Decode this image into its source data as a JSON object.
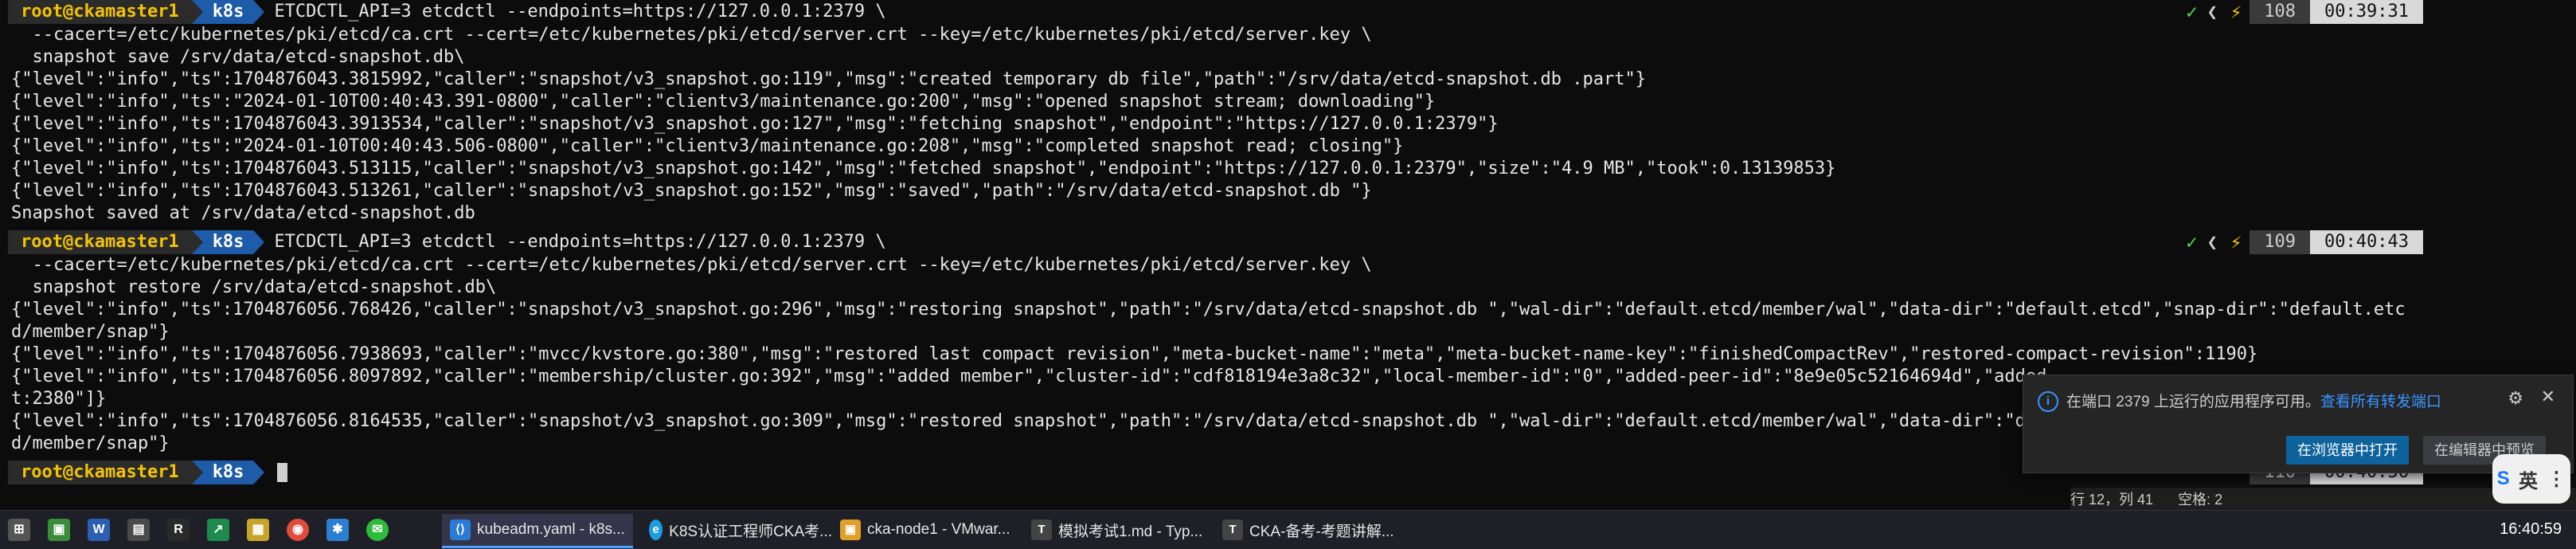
{
  "terminal": {
    "prompts": [
      {
        "user": "root@ckamaster1",
        "dir": "k8s",
        "command": "ETCDCTL_API=3 etcdctl --endpoints=https://127.0.0.1:2379 \\",
        "status": {
          "check": "✓",
          "sep": "❮",
          "bolt": "⚡",
          "count": "108",
          "time": "00:39:31"
        }
      },
      {
        "user": "root@ckamaster1",
        "dir": "k8s",
        "command": "ETCDCTL_API=3 etcdctl --endpoints=https://127.0.0.1:2379 \\",
        "status": {
          "check": "✓",
          "sep": "❮",
          "bolt": "⚡",
          "count": "109",
          "time": "00:40:43"
        }
      },
      {
        "user": "root@ckamaster1",
        "dir": "k8s",
        "command": "",
        "status": {
          "check": "",
          "sep": "",
          "bolt": "",
          "count": "110",
          "time": "00:40:56"
        }
      }
    ],
    "block1": [
      "  --cacert=/etc/kubernetes/pki/etcd/ca.crt --cert=/etc/kubernetes/pki/etcd/server.crt --key=/etc/kubernetes/pki/etcd/server.key \\",
      "  snapshot save /srv/data/etcd-snapshot.db\\",
      "{\"level\":\"info\",\"ts\":1704876043.3815992,\"caller\":\"snapshot/v3_snapshot.go:119\",\"msg\":\"created temporary db file\",\"path\":\"/srv/data/etcd-snapshot.db .part\"}",
      "{\"level\":\"info\",\"ts\":\"2024-01-10T00:40:43.391-0800\",\"caller\":\"clientv3/maintenance.go:200\",\"msg\":\"opened snapshot stream; downloading\"}",
      "{\"level\":\"info\",\"ts\":1704876043.3913534,\"caller\":\"snapshot/v3_snapshot.go:127\",\"msg\":\"fetching snapshot\",\"endpoint\":\"https://127.0.0.1:2379\"}",
      "{\"level\":\"info\",\"ts\":\"2024-01-10T00:40:43.506-0800\",\"caller\":\"clientv3/maintenance.go:208\",\"msg\":\"completed snapshot read; closing\"}",
      "{\"level\":\"info\",\"ts\":1704876043.513115,\"caller\":\"snapshot/v3_snapshot.go:142\",\"msg\":\"fetched snapshot\",\"endpoint\":\"https://127.0.0.1:2379\",\"size\":\"4.9 MB\",\"took\":0.13139853}",
      "{\"level\":\"info\",\"ts\":1704876043.513261,\"caller\":\"snapshot/v3_snapshot.go:152\",\"msg\":\"saved\",\"path\":\"/srv/data/etcd-snapshot.db \"}",
      "Snapshot saved at /srv/data/etcd-snapshot.db"
    ],
    "block2": [
      "  --cacert=/etc/kubernetes/pki/etcd/ca.crt --cert=/etc/kubernetes/pki/etcd/server.crt --key=/etc/kubernetes/pki/etcd/server.key \\",
      "  snapshot restore /srv/data/etcd-snapshot.db\\",
      "{\"level\":\"info\",\"ts\":1704876056.768426,\"caller\":\"snapshot/v3_snapshot.go:296\",\"msg\":\"restoring snapshot\",\"path\":\"/srv/data/etcd-snapshot.db \",\"wal-dir\":\"default.etcd/member/wal\",\"data-dir\":\"default.etcd\",\"snap-dir\":\"default.etc",
      "d/member/snap\"}",
      "{\"level\":\"info\",\"ts\":1704876056.7938693,\"caller\":\"mvcc/kvstore.go:380\",\"msg\":\"restored last compact revision\",\"meta-bucket-name\":\"meta\",\"meta-bucket-name-key\":\"finishedCompactRev\",\"restored-compact-revision\":1190}",
      "{\"level\":\"info\",\"ts\":1704876056.8097892,\"caller\":\"membership/cluster.go:392\",\"msg\":\"added member\",\"cluster-id\":\"cdf818194e3a8c32\",\"local-member-id\":\"0\",\"added-peer-id\":\"8e9e05c52164694d\",\"added-",
      "t:2380\"]}",
      "{\"level\":\"info\",\"ts\":1704876056.8164535,\"caller\":\"snapshot/v3_snapshot.go:309\",\"msg\":\"restored snapshot\",\"path\":\"/srv/data/etcd-snapshot.db \",\"wal-dir\":\"default.etcd/member/wal\",\"data-dir\":\"defa",
      "d/member/snap\"}"
    ]
  },
  "notification": {
    "message": "在端口 2379 上运行的应用程序可用。",
    "link": "查看所有转发端口",
    "primary_button": "在浏览器中打开",
    "secondary_button": "在编辑器中预览"
  },
  "editor_status": {
    "position": "行 12，列 41",
    "spaces": "空格: 2"
  },
  "ime": {
    "logo": "S",
    "mode": "英"
  },
  "taskbar": {
    "apps": [
      {
        "label": "kubeadm.yaml - k8s...",
        "icon_color": "#2b7bd6"
      },
      {
        "label": "K8S认证工程师CKA考...",
        "icon_color": "#1b9de2"
      },
      {
        "label": "cka-node1 - VMwar...",
        "icon_color": "#e0a02a"
      },
      {
        "label": "模拟考试1.md - Typ...",
        "icon_color": "#444444"
      },
      {
        "label": "CKA-备考-考题讲解...",
        "icon_color": "#444444"
      }
    ],
    "clock": "16:40:59"
  }
}
